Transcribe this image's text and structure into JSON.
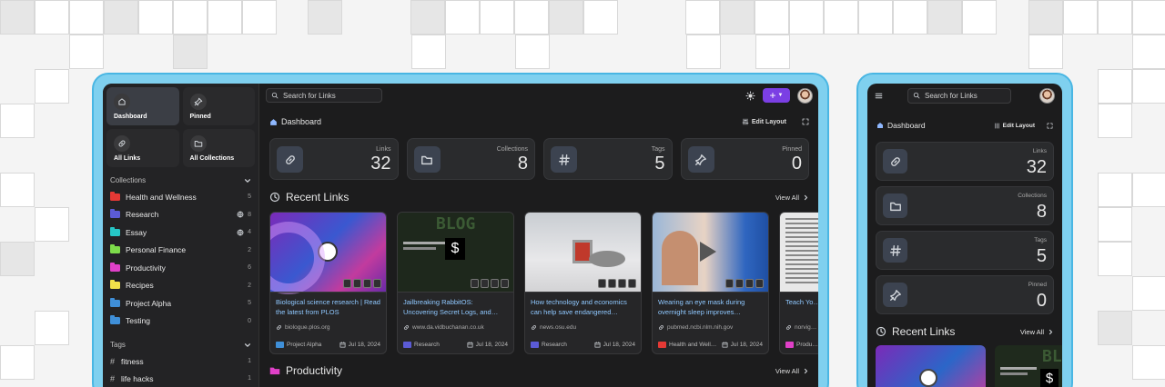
{
  "desktop": {
    "sidebar": {
      "quick": [
        {
          "label": "Dashboard",
          "icon": "home-icon",
          "active": true
        },
        {
          "label": "Pinned",
          "icon": "pin-icon",
          "active": false
        },
        {
          "label": "All Links",
          "icon": "link-icon",
          "active": false
        },
        {
          "label": "All Collections",
          "icon": "folder-icon",
          "active": false
        }
      ],
      "collections_heading": "Collections",
      "collections": [
        {
          "name": "Health and Wellness",
          "count": "5",
          "color": "#e53935",
          "public": false
        },
        {
          "name": "Research",
          "count": "8",
          "color": "#5b5bd6",
          "public": true
        },
        {
          "name": "Essay",
          "count": "4",
          "color": "#26c6c6",
          "public": true
        },
        {
          "name": "Personal Finance",
          "count": "2",
          "color": "#7ddc4a",
          "public": false
        },
        {
          "name": "Productivity",
          "count": "6",
          "color": "#e040c8",
          "public": false
        },
        {
          "name": "Recipes",
          "count": "2",
          "color": "#f2e14a",
          "public": false
        },
        {
          "name": "Project Alpha",
          "count": "5",
          "color": "#3f8fd8",
          "public": false
        },
        {
          "name": "Testing",
          "count": "0",
          "color": "#3f8fd8",
          "public": false
        }
      ],
      "tags_heading": "Tags",
      "tags": [
        {
          "name": "fitness",
          "count": "1"
        },
        {
          "name": "life hacks",
          "count": "1"
        }
      ]
    },
    "topbar": {
      "search_placeholder": "Search for Links",
      "plus": "+"
    },
    "dashboard": {
      "title": "Dashboard",
      "edit_layout": "Edit Layout"
    },
    "stats": [
      {
        "label": "Links",
        "value": "32",
        "icon": "link-icon"
      },
      {
        "label": "Collections",
        "value": "8",
        "icon": "folder-icon"
      },
      {
        "label": "Tags",
        "value": "5",
        "icon": "hash-icon"
      },
      {
        "label": "Pinned",
        "value": "0",
        "icon": "pin-icon"
      }
    ],
    "recent": {
      "title": "Recent Links",
      "view_all": "View All",
      "cards": [
        {
          "title": "Biological science research | Read the latest from PLOS",
          "url": "biologue.plos.org",
          "collection": "Project Alpha",
          "collection_color": "#3f8fd8",
          "date": "Jul 18, 2024"
        },
        {
          "title": "Jailbreaking RabbitOS: Uncovering Secret Logs, and…",
          "url": "www.da.vidbuchanan.co.uk",
          "collection": "Research",
          "collection_color": "#5b5bd6",
          "date": "Jul 18, 2024",
          "image_text": "BLOG",
          "glyph": "$"
        },
        {
          "title": "How technology and economics can help save endangered…",
          "url": "news.osu.edu",
          "collection": "Research",
          "collection_color": "#5b5bd6",
          "date": "Jul 18, 2024"
        },
        {
          "title": "Wearing an eye mask during overnight sleep improves…",
          "url": "pubmed.ncbi.nlm.nih.gov",
          "collection": "Health and Well…",
          "collection_color": "#e53935",
          "date": "Jul 18, 2024"
        },
        {
          "title": "Teach Yo… Ten Year…",
          "url": "norvig…",
          "collection": "Produ…",
          "collection_color": "#e040c8",
          "date": ""
        }
      ]
    },
    "productivity": {
      "title": "Productivity",
      "view_all": "View All"
    }
  },
  "mobile": {
    "search_placeholder": "Search for Links",
    "dashboard_title": "Dashboard",
    "edit_layout": "Edit Layout",
    "stats": [
      {
        "label": "Links",
        "value": "32"
      },
      {
        "label": "Collections",
        "value": "8"
      },
      {
        "label": "Tags",
        "value": "5"
      },
      {
        "label": "Pinned",
        "value": "0"
      }
    ],
    "recent_title": "Recent Links",
    "view_all": "View All",
    "card_image_text": "BL",
    "card_glyph": "$"
  }
}
